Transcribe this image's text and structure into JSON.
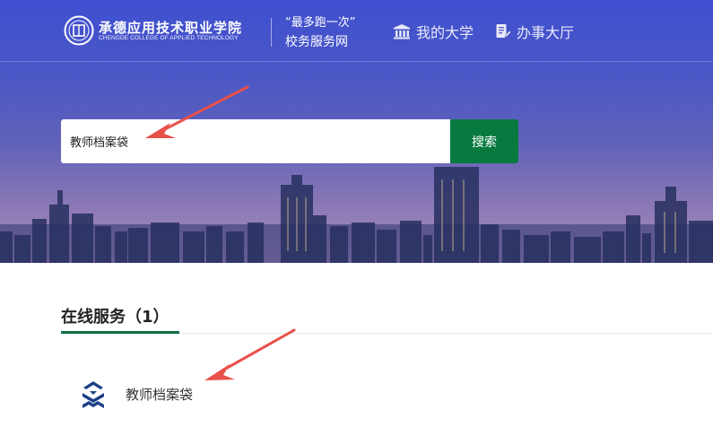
{
  "header": {
    "school_name_cn": "承德应用技术职业学院",
    "school_name_en": "CHENGDE COLLEGE OF APPLIED TECHNOLOGY",
    "slogan_line1": "“最多跑一次”",
    "slogan_line2": "校务服务网",
    "nav": [
      {
        "label": "我的大学",
        "icon": "building-icon"
      },
      {
        "label": "办事大厅",
        "icon": "document-edit-icon"
      }
    ]
  },
  "search": {
    "value": "教师档案袋",
    "placeholder": "",
    "button_label": "搜索"
  },
  "results": {
    "section_title": "在线服务（1）",
    "items": [
      {
        "name": "教师档案袋",
        "icon": "service-logo-icon"
      }
    ]
  },
  "colors": {
    "hero_top": "#3f4fd0",
    "search_button": "#087a3f",
    "tab_active": "#0f6e43",
    "service_icon": "#1d3f86",
    "annotation_arrow": "#e8504a"
  }
}
